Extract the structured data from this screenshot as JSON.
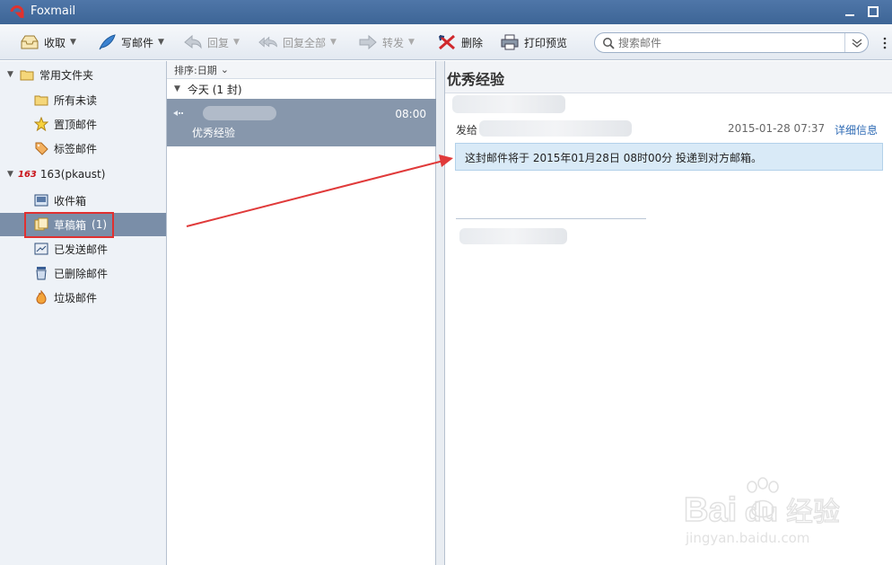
{
  "window": {
    "title": "Foxmail",
    "logo_color": "#e0322e",
    "titlebar_color": "#4a70a2"
  },
  "toolbar": {
    "receive": "收取",
    "compose": "写邮件",
    "reply": "回复",
    "reply_all": "回复全部",
    "forward": "转发",
    "delete": "删除",
    "print_preview": "打印预览",
    "search_placeholder": "搜索邮件"
  },
  "folders": {
    "favorites": "常用文件夹",
    "all_unread": "所有未读",
    "pinned": "置顶邮件",
    "tagged": "标签邮件",
    "account_badge": "163",
    "account": "163(pkaust)",
    "inbox": "收件箱",
    "drafts": "草稿箱",
    "drafts_count": "(1)",
    "sent": "已发送邮件",
    "deleted": "已删除邮件",
    "junk": "垃圾邮件"
  },
  "mail_list": {
    "sort_label": "排序:日期",
    "group_label": "今天 (1 封)",
    "rows": [
      {
        "time": "08:00",
        "subject": "优秀经验"
      }
    ],
    "selected_row_color": "#8797ac"
  },
  "reader": {
    "subject": "优秀经验",
    "to_label": "发给",
    "date": "2015-01-28 07:37",
    "detail_link": "详细信息",
    "schedule_notice": "这封邮件将于 2015年01月28日 08时00分 投递到对方邮箱。",
    "notice_bg": "#d9eaf7"
  },
  "annotation": {
    "box_color": "#e03030"
  },
  "watermark": {
    "brand": "Bai",
    "brand2": "du",
    "cn": "经验",
    "url": "jingyan.baidu.com"
  }
}
